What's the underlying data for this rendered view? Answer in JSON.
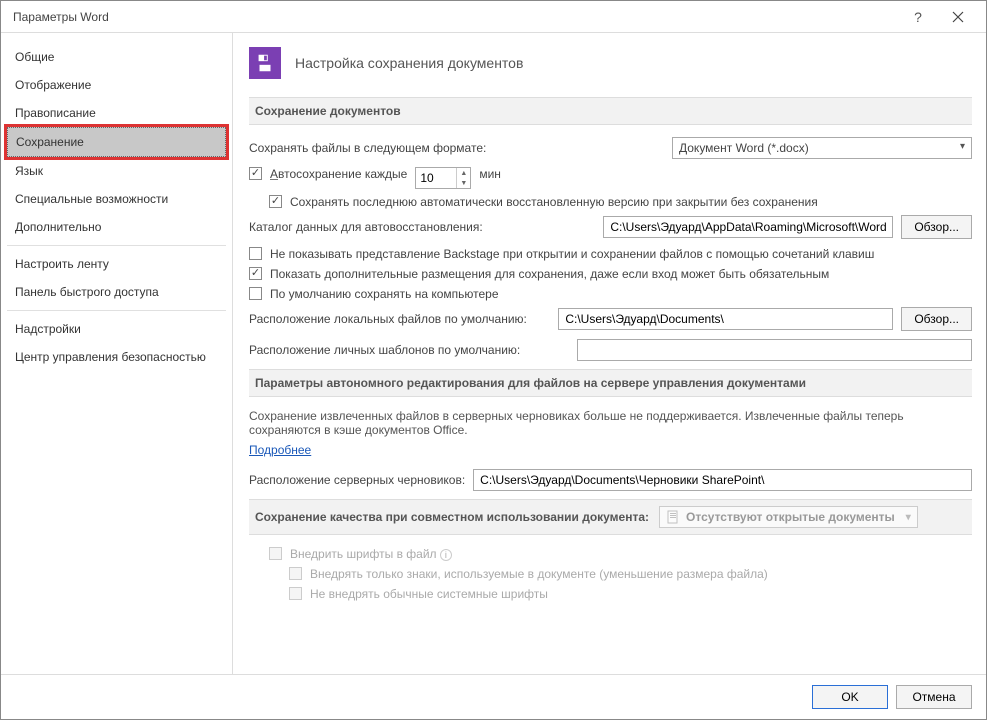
{
  "window": {
    "title": "Параметры Word",
    "help": "?",
    "close": "✕"
  },
  "sidebar": {
    "items": [
      "Общие",
      "Отображение",
      "Правописание",
      "Сохранение",
      "Язык",
      "Специальные возможности",
      "Дополнительно",
      "Настроить ленту",
      "Панель быстрого доступа",
      "Надстройки",
      "Центр управления безопасностью"
    ],
    "selected_index": 3
  },
  "header": {
    "title": "Настройка сохранения документов"
  },
  "section1": {
    "title": "Сохранение документов",
    "save_format_label": "Сохранять файлы в следующем формате:",
    "save_format_value": "Документ Word (*.docx)",
    "autosave_label": "Автосохранение каждые",
    "autosave_value": "10",
    "autosave_unit": "мин",
    "autosave_keep_last": "Сохранять последнюю автоматически восстановленную версию при закрытии без сохранения",
    "autorecover_label": "Каталог данных для автовосстановления:",
    "autorecover_path": "C:\\Users\\Эдуард\\AppData\\Roaming\\Microsoft\\Word\\",
    "browse": "Обзор...",
    "cb_no_backstage": "Не показывать представление Backstage при открытии и сохранении файлов с помощью сочетаний клавиш",
    "cb_additional_loc": "Показать дополнительные размещения для сохранения, даже если вход может быть обязательным",
    "cb_save_local": "По умолчанию сохранять на компьютере",
    "local_files_label": "Расположение локальных файлов по умолчанию:",
    "local_files_path": "C:\\Users\\Эдуард\\Documents\\",
    "personal_templates_label": "Расположение личных шаблонов по умолчанию:",
    "personal_templates_path": ""
  },
  "section2": {
    "title": "Параметры автономного редактирования для файлов на сервере управления документами",
    "info_text": "Сохранение извлеченных файлов в серверных черновиках больше не поддерживается. Извлеченные файлы теперь сохраняются в кэше документов Office.",
    "learn_more": "Подробнее",
    "drafts_label": "Расположение серверных черновиков:",
    "drafts_path": "C:\\Users\\Эдуард\\Documents\\Черновики SharePoint\\"
  },
  "section3": {
    "title": "Сохранение качества при совместном использовании документа:",
    "dropdown_text": "Отсутствуют открытые документы",
    "cb_embed_fonts": "Внедрить шрифты в файл",
    "cb_embed_only_used": "Внедрять только знаки, используемые в документе (уменьшение размера файла)",
    "cb_no_common_fonts": "Не внедрять обычные системные шрифты"
  },
  "footer": {
    "ok": "OK",
    "cancel": "Отмена"
  }
}
